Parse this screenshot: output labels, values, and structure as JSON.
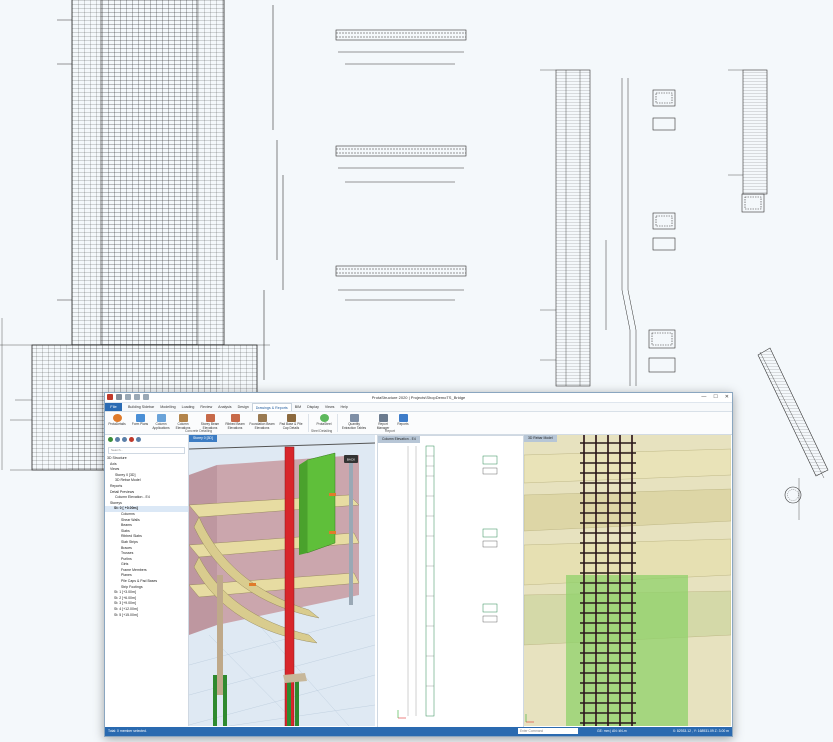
{
  "app": {
    "title": "ProtaStructure 2020 | Projects\\ShopDemoTS_Bridge",
    "window_controls": [
      "—",
      "☐",
      "✕"
    ]
  },
  "menu": {
    "file": "File",
    "items": [
      "Building Sidebar",
      "Modelling",
      "Loading",
      "Review",
      "Analysis",
      "Design",
      "Drawings & Reports",
      "BIM",
      "Display",
      "Views",
      "Help"
    ],
    "active_index": 6
  },
  "ribbon": {
    "buttons": [
      "ProtaDetails",
      "Form Plans",
      "Column Applications",
      "Column Elevations",
      "Storey Beam Elevations",
      "Ribbed Beam Elevations",
      "Foundation Beam Elevations",
      "Pad Base & Pile Cap Details",
      "ProtaSteel",
      "Quantity Extraction Tables",
      "Report Manager",
      "Reports"
    ],
    "groups": [
      "Concrete Detailing",
      "Steel Detailing",
      "Report"
    ]
  },
  "tree": {
    "filter_placeholder": "Search...",
    "rows": [
      "3D Structure",
      "Axis",
      "Views",
      "Storey 0 [3D]",
      "3D Rebar Model",
      "Reports",
      "Detail Previews",
      "Column Elevation - E4",
      "Storeys",
      "St: 0  [ +0.00m]",
      "Columns",
      "Shear Walls",
      "Beams",
      "Slabs",
      "Ribbed Slabs",
      "Slab Strips",
      "Braces",
      "Trusses",
      "Purlins",
      "Girts",
      "Frame Members",
      "Planes",
      "Pile Caps & Pad Bases",
      "Strip Footings",
      "St: 1  [+3.00m]",
      "St: 2  [+6.00m]",
      "St: 3  [+9.00m]",
      "St: 4  [+12.00m]",
      "St: 5  [+15.00m]"
    ]
  },
  "viewports": {
    "view1_tab": "Storey 0 [3D]",
    "view2_tab": "Column Elevation - E4",
    "view3_tab": "3D Rebar Model",
    "back_label": "BACK"
  },
  "status": {
    "left": "Total: 0 member selected.",
    "command_placeholder": "Enter Command",
    "units": "GE: mm  |  AN: kN-m",
    "coords": "X: 82933.12 , Y: 168931.09      Z: 3.00 m"
  },
  "colors": {
    "accent": "#2a6ab0",
    "column_red": "#d8262b",
    "wall_green": "#5fbf3a",
    "slab_cream": "#e7dca2",
    "wall_pink": "#c89aa0"
  }
}
